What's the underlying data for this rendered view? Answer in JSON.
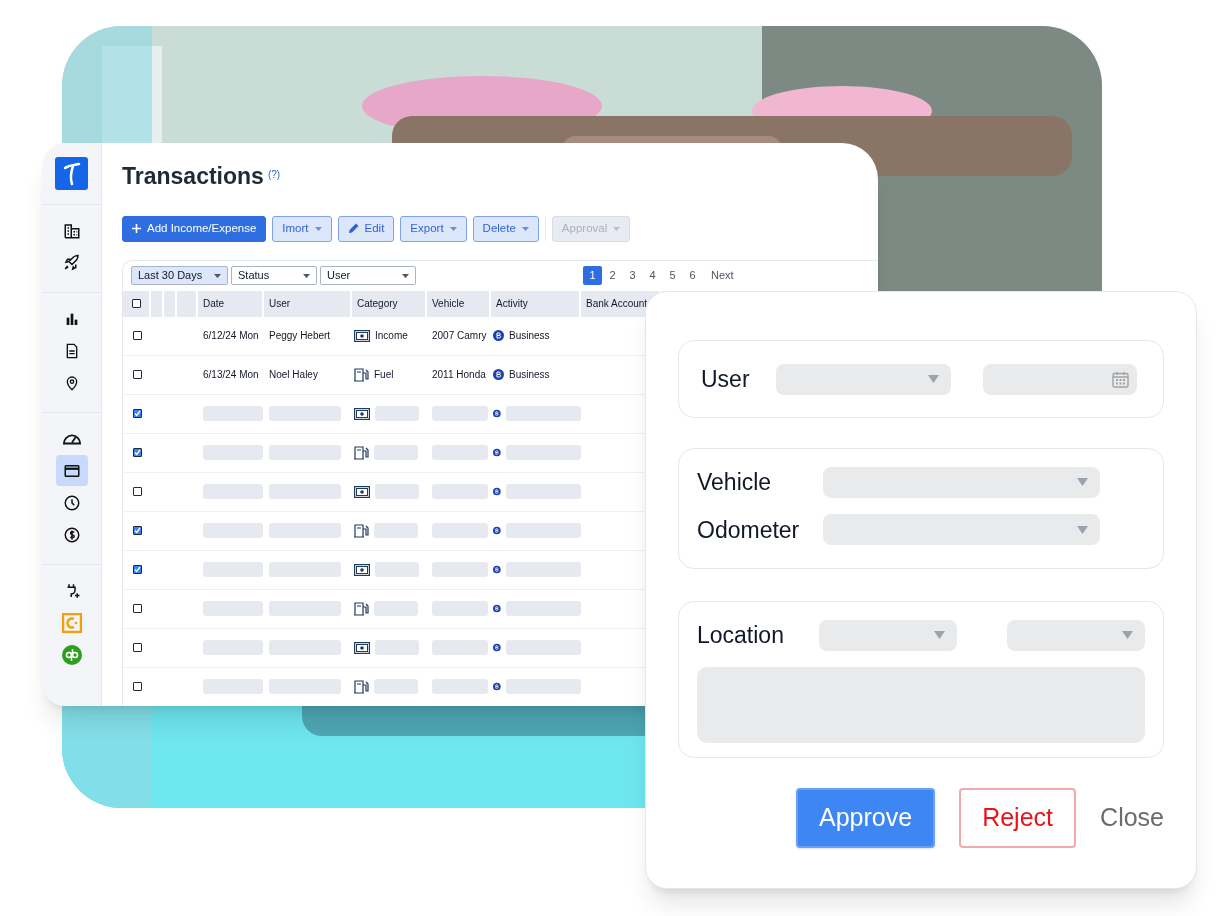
{
  "sidebar": {
    "groups": [
      [
        {
          "selected": false
        },
        {
          "selected": false
        }
      ],
      [
        {
          "selected": false
        },
        {
          "selected": false
        },
        {
          "selected": false
        }
      ],
      [
        {
          "selected": false
        },
        {
          "selected": true
        },
        {
          "selected": false
        },
        {
          "selected": false
        }
      ],
      [
        {
          "selected": false
        },
        {
          "selected": false
        },
        {
          "selected": false
        }
      ]
    ]
  },
  "page": {
    "title": "Transactions",
    "help": "(?)"
  },
  "toolbar": [
    {
      "label": "Add Income/Expense",
      "kind": "add",
      "disabled": false
    },
    {
      "label": "Imort",
      "kind": "menu",
      "disabled": false
    },
    {
      "label": "Edit",
      "kind": "edit",
      "disabled": false
    },
    {
      "label": "Export",
      "kind": "menu",
      "disabled": false
    },
    {
      "label": "Delete",
      "kind": "menu",
      "disabled": false
    },
    {
      "label": "Approval",
      "kind": "menu",
      "disabled": true
    }
  ],
  "filters": [
    {
      "value": "Last 30 Days",
      "selected": true
    },
    {
      "value": "Status",
      "selected": false
    },
    {
      "value": "User",
      "selected": false
    }
  ],
  "pagination": {
    "pages": [
      {
        "label": "1",
        "selected": true
      },
      {
        "label": "2",
        "selected": false
      },
      {
        "label": "3",
        "selected": false
      },
      {
        "label": "4",
        "selected": false
      },
      {
        "label": "5",
        "selected": false
      },
      {
        "label": "6",
        "selected": false
      }
    ],
    "next": "Next"
  },
  "table": {
    "header_checked": false,
    "columns": [
      "Date",
      "User",
      "Category",
      "Vehicle",
      "Activity",
      "Bank Account"
    ],
    "rows": [
      {
        "kind": "filled",
        "checked": false,
        "date": "6/12/24 Mon",
        "user": "Peggy Hebert",
        "category": {
          "label": "Income",
          "kind": "income"
        },
        "vehicle": "2007 Camry",
        "activity": "Business"
      },
      {
        "kind": "filled",
        "checked": false,
        "date": "6/13/24 Mon",
        "user": "Noel Haley",
        "category": {
          "label": "Fuel",
          "kind": "fuel"
        },
        "vehicle": "2011 Honda",
        "activity": "Business"
      },
      {
        "kind": "placeholder",
        "checked": true,
        "category": {
          "kind": "income"
        }
      },
      {
        "kind": "placeholder",
        "checked": true,
        "category": {
          "kind": "fuel"
        }
      },
      {
        "kind": "placeholder",
        "checked": false,
        "category": {
          "kind": "income"
        }
      },
      {
        "kind": "placeholder",
        "checked": true,
        "category": {
          "kind": "fuel"
        }
      },
      {
        "kind": "placeholder",
        "checked": true,
        "category": {
          "kind": "income"
        }
      },
      {
        "kind": "placeholder",
        "checked": false,
        "category": {
          "kind": "fuel"
        }
      },
      {
        "kind": "placeholder",
        "checked": false,
        "category": {
          "kind": "income"
        }
      },
      {
        "kind": "placeholder",
        "checked": false,
        "category": {
          "kind": "fuel"
        }
      }
    ]
  },
  "dialog": {
    "user_label": "User",
    "vehicle_label": "Vehicle",
    "odometer_label": "Odometer",
    "location_label": "Location",
    "buttons": [
      {
        "label": "Approve",
        "kind": "primary"
      },
      {
        "label": "Reject",
        "kind": "danger"
      },
      {
        "label": "Close",
        "kind": "plain"
      }
    ]
  }
}
